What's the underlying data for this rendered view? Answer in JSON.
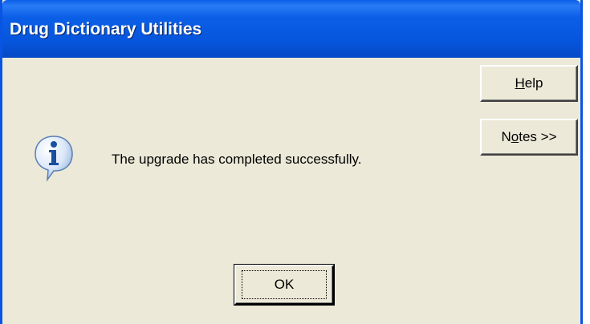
{
  "window": {
    "title": "Drug Dictionary Utilities"
  },
  "dialog": {
    "icon": "information-icon",
    "message": "The upgrade has completed successfully."
  },
  "buttons": {
    "help": {
      "accel": "H",
      "rest": "elp"
    },
    "notes": {
      "pre": "N",
      "accel": "o",
      "rest": "tes >>"
    },
    "ok": "OK"
  },
  "colors": {
    "titlebar": "#0656dd",
    "face": "#ece9d8",
    "border": "#0a54e3"
  }
}
